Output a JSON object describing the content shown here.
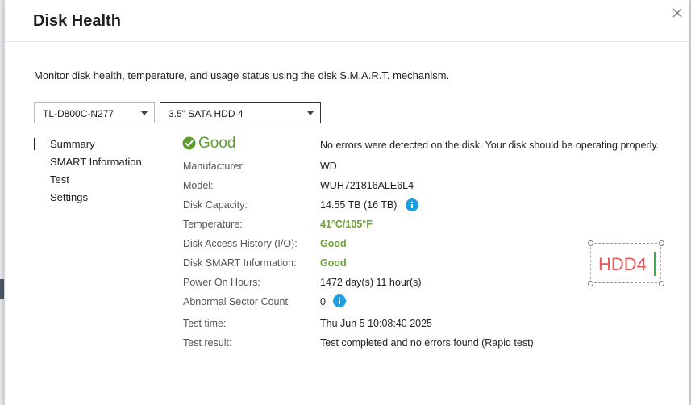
{
  "dialog": {
    "title": "Disk Health",
    "description": "Monitor disk health, temperature, and usage status using the disk S.M.A.R.T. mechanism."
  },
  "selectors": {
    "enclosure": "TL-D800C-N277",
    "disk": "3.5\" SATA HDD 4"
  },
  "nav": {
    "items": [
      {
        "label": "Summary",
        "active": true
      },
      {
        "label": "SMART Information"
      },
      {
        "label": "Test"
      },
      {
        "label": "Settings"
      }
    ]
  },
  "summary": {
    "status": "Good",
    "status_message": "No errors were detected on the disk. Your disk should be operating properly.",
    "fields": {
      "manufacturer": {
        "label": "Manufacturer:",
        "value": "WD"
      },
      "model": {
        "label": "Model:",
        "value": "WUH721816ALE6L4"
      },
      "capacity": {
        "label": "Disk Capacity:",
        "value": "14.55 TB (16 TB)"
      },
      "temperature": {
        "label": "Temperature:",
        "value": "41°C/105°F"
      },
      "access_history": {
        "label": "Disk Access History (I/O):",
        "value": "Good"
      },
      "smart_info": {
        "label": "Disk SMART Information:",
        "value": "Good"
      },
      "power_on_hours": {
        "label": "Power On Hours:",
        "value": "1472 day(s) 11 hour(s)"
      },
      "abnormal_sectors": {
        "label": "Abnormal Sector Count:",
        "value": "0"
      },
      "test_time": {
        "label": "Test time:",
        "value": "Thu Jun 5 10:08:40 2025"
      },
      "test_result": {
        "label": "Test result:",
        "value": "Test completed and no errors found (Rapid test)"
      }
    }
  },
  "disk_label": "HDD4",
  "colors": {
    "good": "#6aa336",
    "info": "#1a9fe0",
    "disk_label": "#e45b5b"
  }
}
